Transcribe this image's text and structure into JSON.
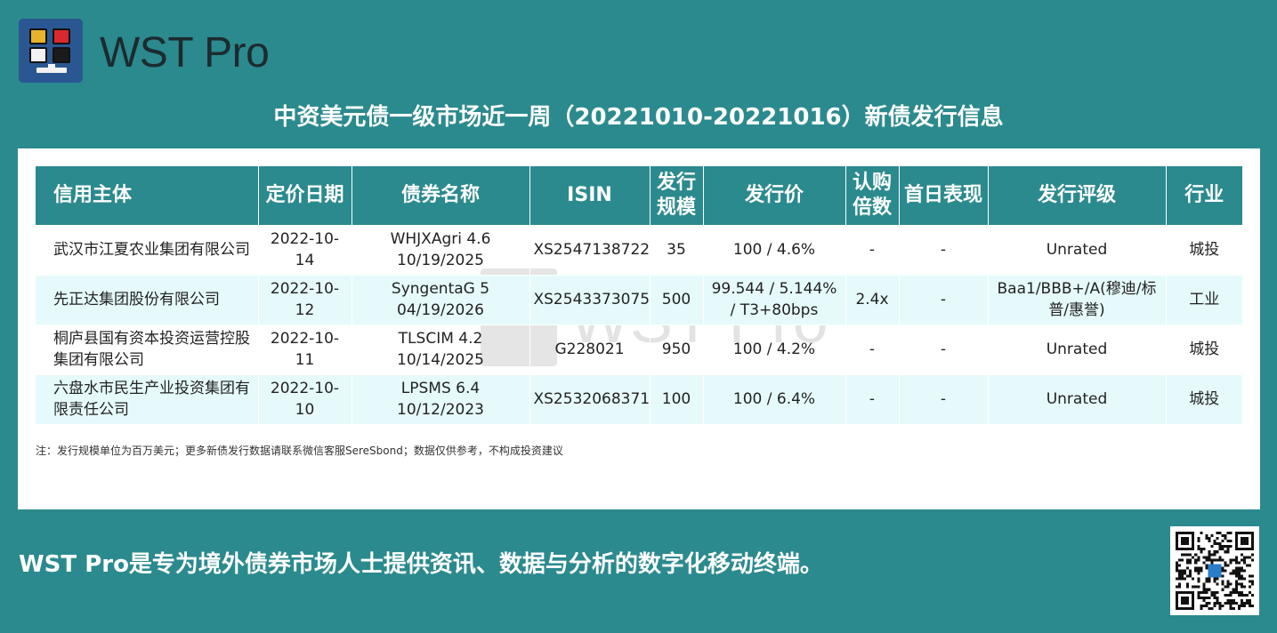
{
  "header": {
    "brand": "WST Pro",
    "title": "中资美元债一级市场近一周（20221010-20221016）新债发行信息"
  },
  "table": {
    "columns": [
      "信用主体",
      "定价日期",
      "债券名称",
      "ISIN",
      "发行规模",
      "发行价",
      "认购倍数",
      "首日表现",
      "发行评级",
      "行业"
    ],
    "columns_display": {
      "scale": [
        "发行",
        "规模"
      ],
      "multiple": [
        "认购",
        "倍数"
      ]
    },
    "rows": [
      {
        "issuer": "武汉市江夏农业集团有限公司",
        "date": "2022-10-14",
        "bond": [
          "WHJXAgri 4.6",
          "10/19/2025"
        ],
        "isin": "XS2547138722",
        "size": "35",
        "price": "100 / 4.6%",
        "multiple": "-",
        "first_day": "-",
        "rating": "Unrated",
        "industry": "城投"
      },
      {
        "issuer": "先正达集团股份有限公司",
        "date": "2022-10-12",
        "bond": [
          "SyngentaG 5",
          "04/19/2026"
        ],
        "isin": "XS2543373075",
        "size": "500",
        "price": "99.544 / 5.144% / T3+80bps",
        "multiple": "2.4x",
        "first_day": "-",
        "rating": "Baa1/BBB+/A(穆迪/标普/惠誉)",
        "industry": "工业"
      },
      {
        "issuer": "桐庐县国有资本投资运营控股集团有限公司",
        "date": "2022-10-11",
        "bond": [
          "TLSCIM 4.2",
          "10/14/2025"
        ],
        "isin": "G228021",
        "size": "950",
        "price": "100 / 4.2%",
        "multiple": "-",
        "first_day": "-",
        "rating": "Unrated",
        "industry": "城投"
      },
      {
        "issuer": "六盘水市民生产业投资集团有限责任公司",
        "date": "2022-10-10",
        "bond": [
          "LPSMS 6.4",
          "10/12/2023"
        ],
        "isin": "XS2532068371",
        "size": "100",
        "price": "100 / 6.4%",
        "multiple": "-",
        "first_day": "-",
        "rating": "Unrated",
        "industry": "城投"
      }
    ],
    "note": "注：发行规模单位为百万美元；更多新债发行数据请联系微信客服SereSbond；数据仅供参考，不构成投资建议"
  },
  "watermark": {
    "text": "WST Pro"
  },
  "footer": {
    "tagline": "WST Pro是专为境外债券市场人士提供资讯、数据与分析的数字化移动终端。"
  },
  "icons": {
    "logo": "wst-logo-icon",
    "qr": "qr-code-icon"
  },
  "colors": {
    "background": "#2b8a8e",
    "logo_bg": "#2a5791",
    "header_row": "#2b8a8e",
    "alt_row": "#e6fafb"
  }
}
